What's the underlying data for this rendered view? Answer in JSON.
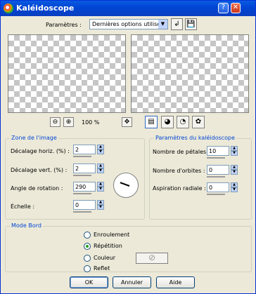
{
  "window": {
    "title": "Kaléidoscope",
    "help_glyph": "?",
    "close_glyph": "✕"
  },
  "presets": {
    "label": "Paramètres :",
    "selected": "Dernières options utilisées",
    "arrow_glyph": "▼",
    "load_glyph": "↲",
    "save_glyph": "💾"
  },
  "preview_toolbar": {
    "zoom_out_glyph": "⊖",
    "zoom_in_glyph": "⊕",
    "zoom_level": "100 %",
    "move_glyph": "✥",
    "tools": [
      "▤",
      "◕",
      "◔",
      "✿"
    ]
  },
  "image_zone": {
    "title": "Zone de l'image",
    "fields": [
      {
        "label": "Décalage horiz. (%) :",
        "value": "2"
      },
      {
        "label": "Décalage vert. (%) :",
        "value": "2"
      },
      {
        "label": "Angle de rotation :",
        "value": "290"
      },
      {
        "label": "Échelle :",
        "value": "0"
      }
    ]
  },
  "kaleido_params": {
    "title": "Paramètres du kaléidoscope",
    "fields": [
      {
        "label": "Nombre de pétales :",
        "value": "10"
      },
      {
        "label": "Nombre d'orbites :",
        "value": "0"
      },
      {
        "label": "Aspiration radiale :",
        "value": "0"
      }
    ]
  },
  "edge_mode": {
    "title": "Mode Bord",
    "options": [
      {
        "label": "Enroulement",
        "selected": false
      },
      {
        "label": "Répétition",
        "selected": true
      },
      {
        "label": "Couleur",
        "selected": false
      },
      {
        "label": "Reflet",
        "selected": false
      }
    ],
    "color_swatch_glyph": "⊘"
  },
  "spin_glyphs": {
    "up": "▲",
    "down": "▼"
  },
  "buttons": {
    "ok": "OK",
    "cancel": "Annuler",
    "help": "Aide"
  }
}
